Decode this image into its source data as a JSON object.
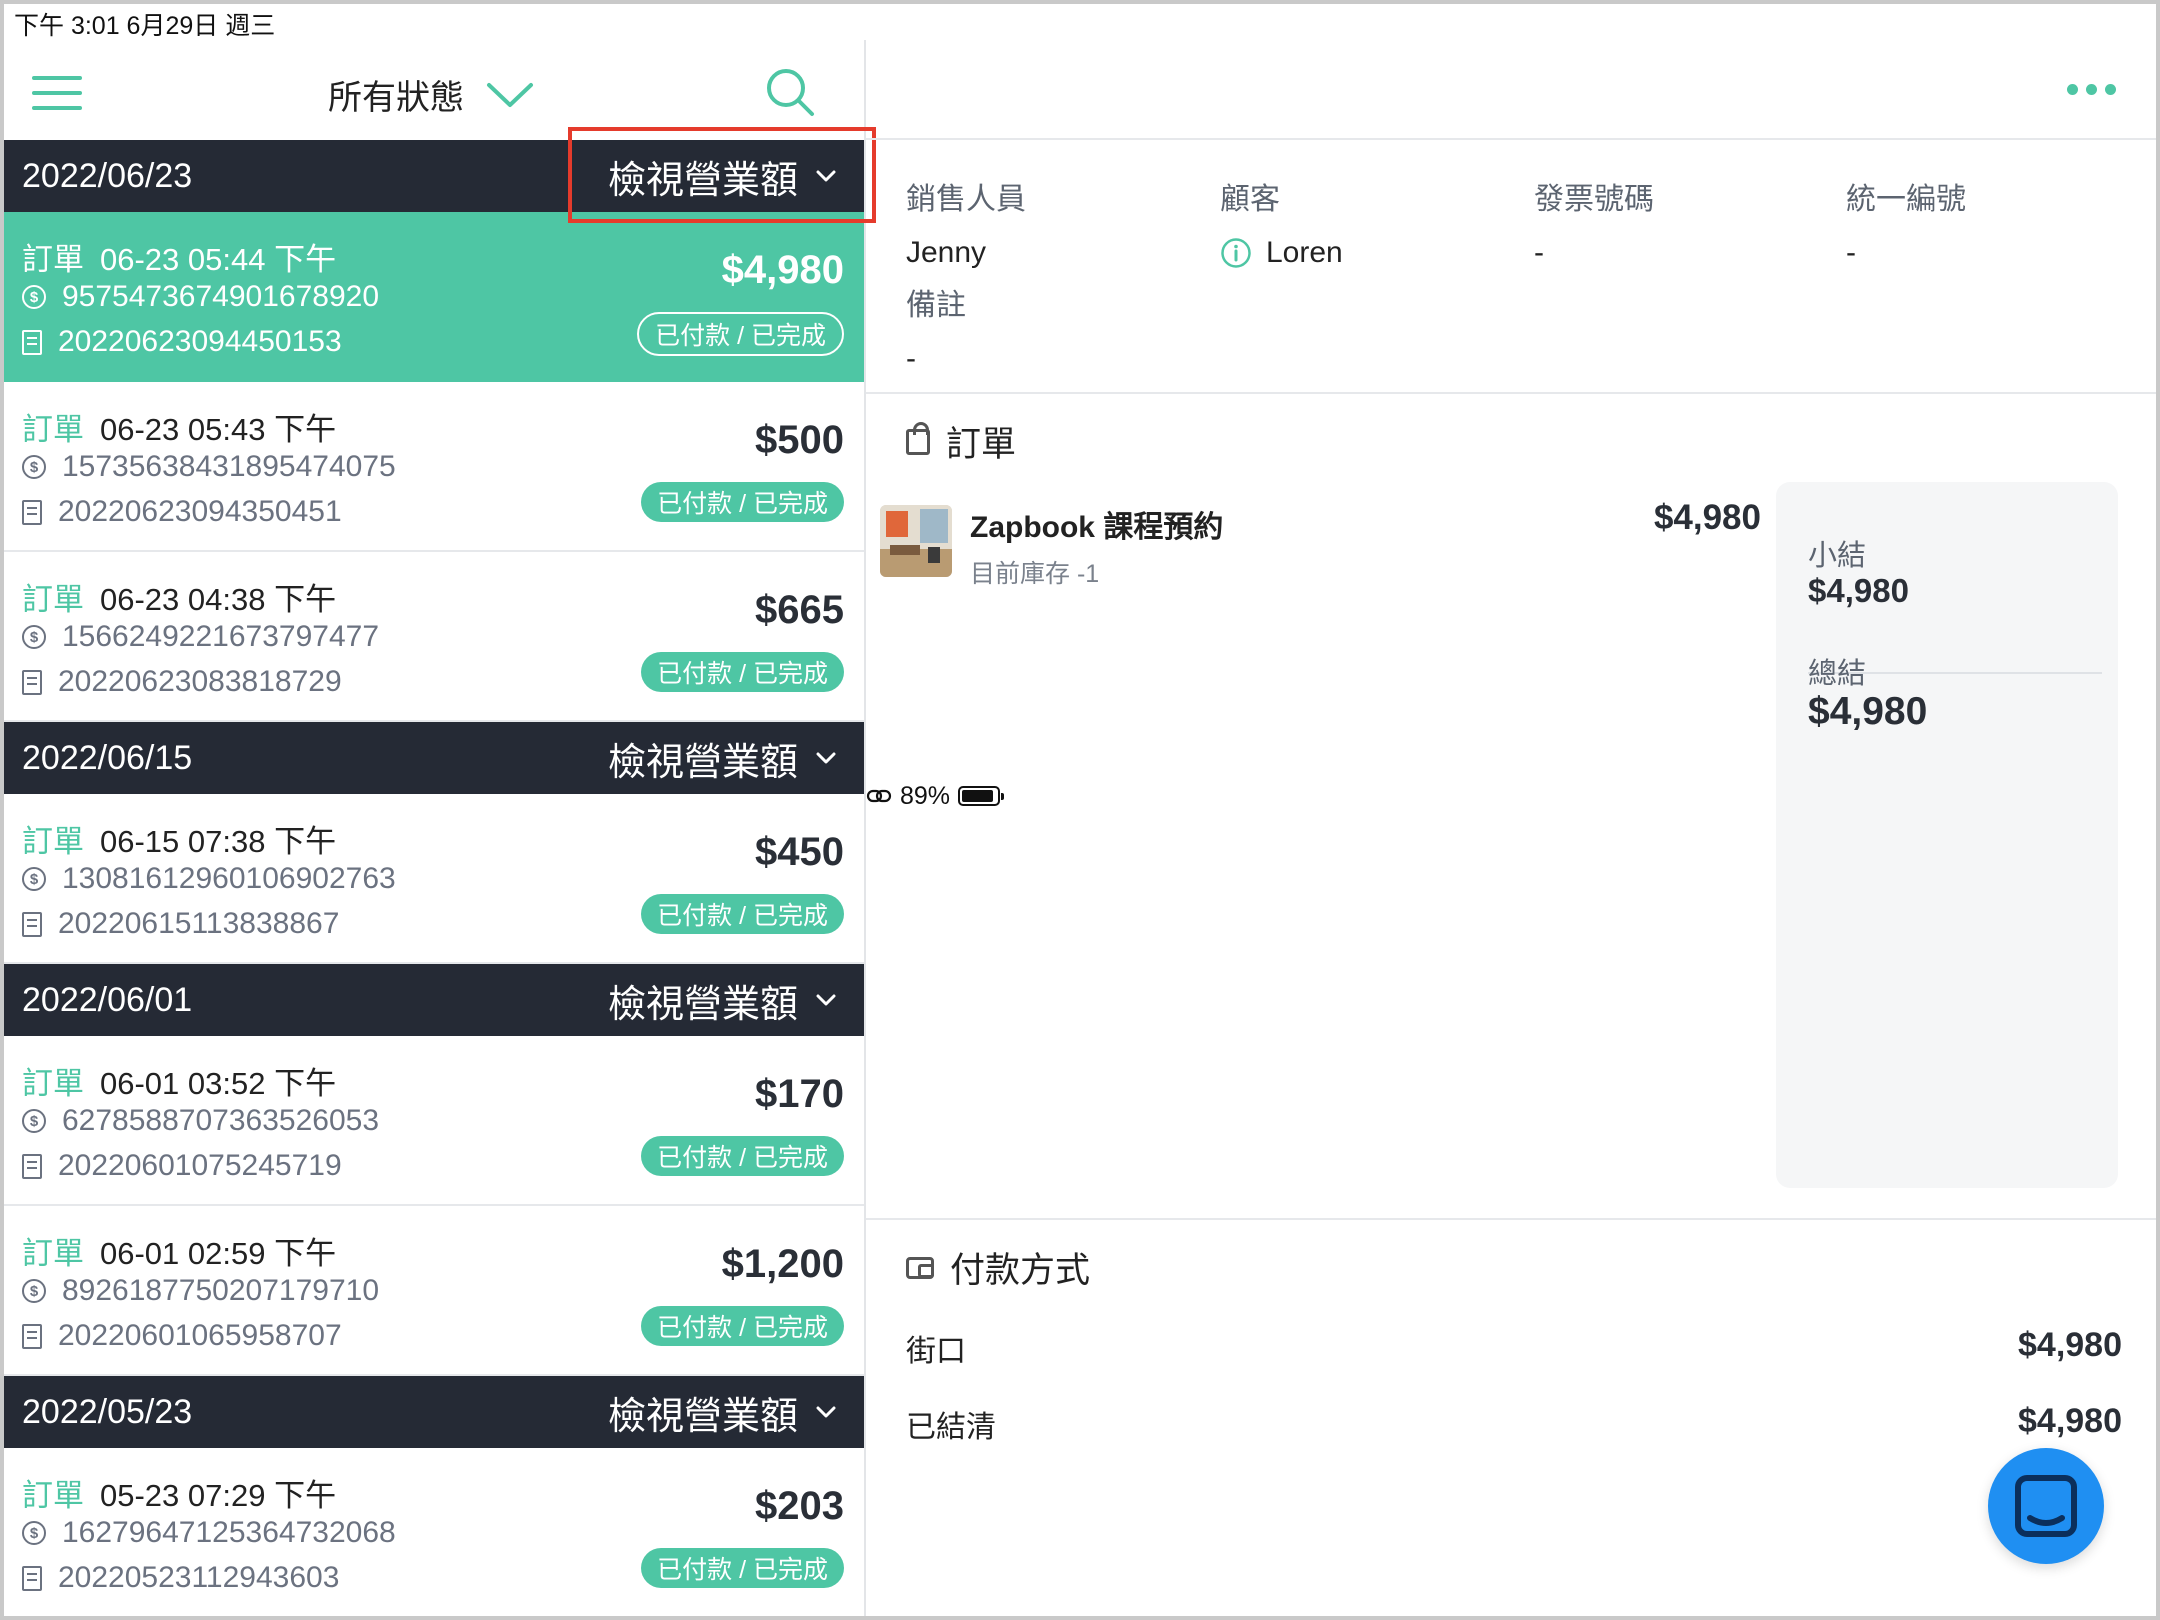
{
  "status_bar": {
    "time": "下午 3:01   6月29日 週三",
    "battery": "89%"
  },
  "list_header": {
    "filter_label": "所有狀態"
  },
  "revenue_label": "檢視營業額",
  "order_key": "訂單",
  "groups": [
    {
      "date": "2022/06/23",
      "orders": [
        {
          "time": "06-23 05:44 下午",
          "txn": "9575473674901678920",
          "receipt": "20220623094450153",
          "amount": "$4,980",
          "status": "已付款 / 已完成"
        },
        {
          "time": "06-23 05:43 下午",
          "txn": "15735638431895474075",
          "receipt": "20220623094350451",
          "amount": "$500",
          "status": "已付款 / 已完成"
        },
        {
          "time": "06-23 04:38 下午",
          "txn": "1566249221673797477",
          "receipt": "20220623083818729",
          "amount": "$665",
          "status": "已付款 / 已完成"
        }
      ]
    },
    {
      "date": "2022/06/15",
      "orders": [
        {
          "time": "06-15 07:38 下午",
          "txn": "13081612960106902763",
          "receipt": "20220615113838867",
          "amount": "$450",
          "status": "已付款 / 已完成"
        }
      ]
    },
    {
      "date": "2022/06/01",
      "orders": [
        {
          "time": "06-01 03:52 下午",
          "txn": "6278588707363526053",
          "receipt": "20220601075245719",
          "amount": "$170",
          "status": "已付款 / 已完成"
        },
        {
          "time": "06-01 02:59 下午",
          "txn": "8926187750207179710",
          "receipt": "20220601065958707",
          "amount": "$1,200",
          "status": "已付款 / 已完成"
        }
      ]
    },
    {
      "date": "2022/05/23",
      "orders": [
        {
          "time": "05-23 07:29 下午",
          "txn": "16279647125364732068",
          "receipt": "20220523112943603",
          "amount": "$203",
          "status": "已付款 / 已完成"
        }
      ]
    }
  ],
  "detail": {
    "salesperson_label": "銷售人員",
    "salesperson": "Jenny",
    "customer_label": "顧客",
    "customer": "Loren",
    "invoice_label": "發票號碼",
    "invoice": "-",
    "tax_id_label": "統一編號",
    "tax_id": "-",
    "note_label": "備註",
    "note": "-",
    "order_section": "訂單",
    "product_name": "Zapbook 課程預約",
    "product_stock": "目前庫存 -1",
    "product_amount": "$4,980",
    "subtotal_label": "小結",
    "subtotal": "$4,980",
    "total_label": "總結",
    "total": "$4,980",
    "payment_section": "付款方式",
    "payment_method": "街口",
    "payment_amount": "$4,980",
    "settled_label": "已結清",
    "settled_amount": "$4,980"
  },
  "colors": {
    "accent": "#4ec6a4",
    "header_dark": "#252a35",
    "highlight": "#e53b2c",
    "chat": "#1f8ff2"
  }
}
